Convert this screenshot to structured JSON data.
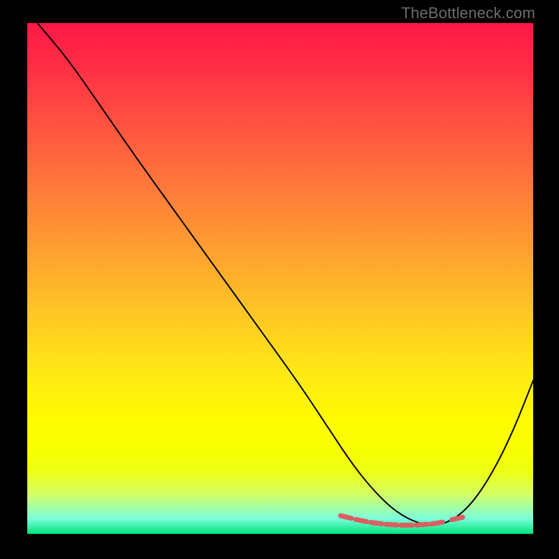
{
  "watermark": "TheBottleneck.com",
  "chart_data": {
    "type": "line",
    "title": "",
    "xlabel": "",
    "ylabel": "",
    "xlim": [
      0,
      100
    ],
    "ylim": [
      0,
      100
    ],
    "series": [
      {
        "name": "bottleneck-curve",
        "x": [
          2,
          8,
          15,
          22,
          30,
          38,
          46,
          54,
          60,
          64,
          68,
          72,
          76,
          80,
          84,
          88,
          92,
          96,
          100
        ],
        "y": [
          100,
          93,
          83,
          73,
          62,
          51,
          40,
          29,
          20,
          14,
          9,
          5,
          2.5,
          1.5,
          2.5,
          6,
          12,
          20,
          30
        ]
      }
    ],
    "markers": {
      "name": "sweet-spot",
      "x": [
        63,
        66,
        69,
        72,
        75,
        78,
        81,
        85
      ],
      "y": [
        3.3,
        2.6,
        2.1,
        1.8,
        1.7,
        1.8,
        2.1,
        3.0
      ]
    },
    "gradient_stops": [
      {
        "pos": 0,
        "color": "#ff1846"
      },
      {
        "pos": 45,
        "color": "#ffa130"
      },
      {
        "pos": 80,
        "color": "#fffc00"
      },
      {
        "pos": 100,
        "color": "#00e57c"
      }
    ]
  }
}
